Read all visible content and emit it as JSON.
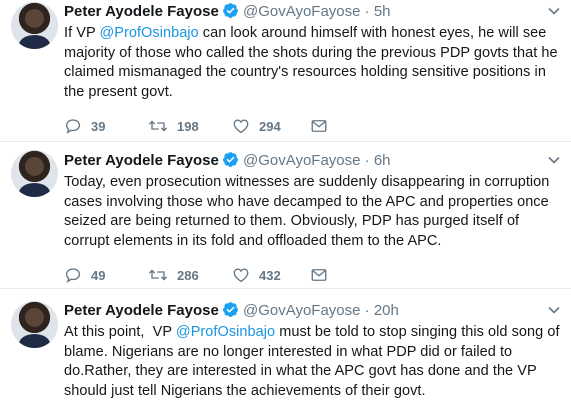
{
  "tweets": [
    {
      "name": "Peter Ayodele Fayose",
      "handle": "@GovAyoFayose",
      "dot": "·",
      "time": "5h",
      "text_parts": [
        "If VP ",
        "@ProfOsinbajo",
        " can look around himself with honest eyes, he will see majority of those who called the shots during the previous PDP govts that he claimed mismanaged the country's resources holding sensitive positions in the present govt."
      ],
      "replies": "39",
      "retweets": "198",
      "likes": "294"
    },
    {
      "name": "Peter Ayodele Fayose",
      "handle": "@GovAyoFayose",
      "dot": "·",
      "time": "6h",
      "text_parts": [
        "Today, even prosecution witnesses are suddenly disappearing in corruption cases involving those who have decamped to the APC and properties once seized are being returned to them. Obviously, PDP has purged itself of corrupt elements in its fold and offloaded them to the APC."
      ],
      "replies": "49",
      "retweets": "286",
      "likes": "432"
    },
    {
      "name": "Peter Ayodele Fayose",
      "handle": "@GovAyoFayose",
      "dot": "·",
      "time": "20h",
      "text_parts": [
        "At this point,  VP ",
        "@ProfOsinbajo",
        " must be told to stop singing this old song of blame. Nigerians are no longer interested in what PDP did or failed to do.Rather, they are interested in what the APC govt has done and the VP should just tell Nigerians the achievements of their govt."
      ]
    }
  ],
  "colors": {
    "accent": "#1b95e0",
    "muted": "#657786",
    "text": "#14171a",
    "divider": "#e6ecf0"
  },
  "icons": [
    "reply-icon",
    "retweet-icon",
    "like-icon",
    "message-icon",
    "verified-icon",
    "chevron-down-icon"
  ]
}
